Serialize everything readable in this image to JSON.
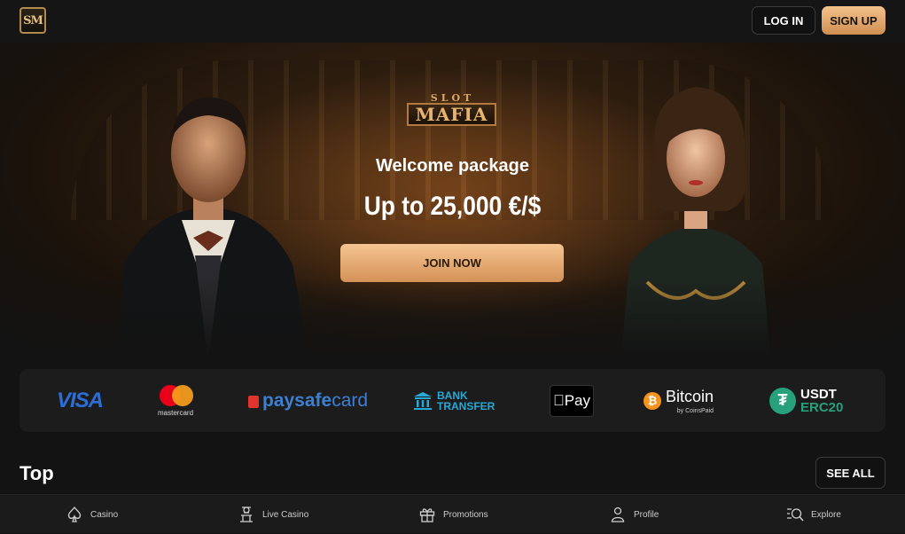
{
  "header": {
    "logo_text": "SM",
    "login_label": "LOG IN",
    "signup_label": "SIGN UP"
  },
  "hero": {
    "brand_top": "SLOT",
    "brand_main": "MAFIA",
    "title": "Welcome package",
    "amount": "Up to 25,000 €/$",
    "cta_label": "JOIN NOW"
  },
  "payments": {
    "visa": "VISA",
    "mastercard": "mastercard",
    "paysafecard_bold": "paysafe",
    "paysafecard_thin": "card",
    "bank_line1": "BANK",
    "bank_line2": "TRANSFER",
    "applepay": "Pay",
    "bitcoin": "Bitcoin",
    "bitcoin_sub": "by CoinsPaid",
    "usdt": "USDT",
    "usdt_sub": "ERC20"
  },
  "top_section": {
    "title": "Top",
    "see_all_label": "SEE ALL"
  },
  "bottom_nav": {
    "items": [
      {
        "label": "Casino",
        "icon": "spade-icon"
      },
      {
        "label": "Live Casino",
        "icon": "dealer-icon"
      },
      {
        "label": "Promotions",
        "icon": "gift-icon"
      },
      {
        "label": "Profile",
        "icon": "user-icon"
      },
      {
        "label": "Explore",
        "icon": "search-list-icon"
      }
    ]
  },
  "colors": {
    "accent_gold": "#e0a468",
    "background": "#131313",
    "panel": "#1c1c1c"
  }
}
